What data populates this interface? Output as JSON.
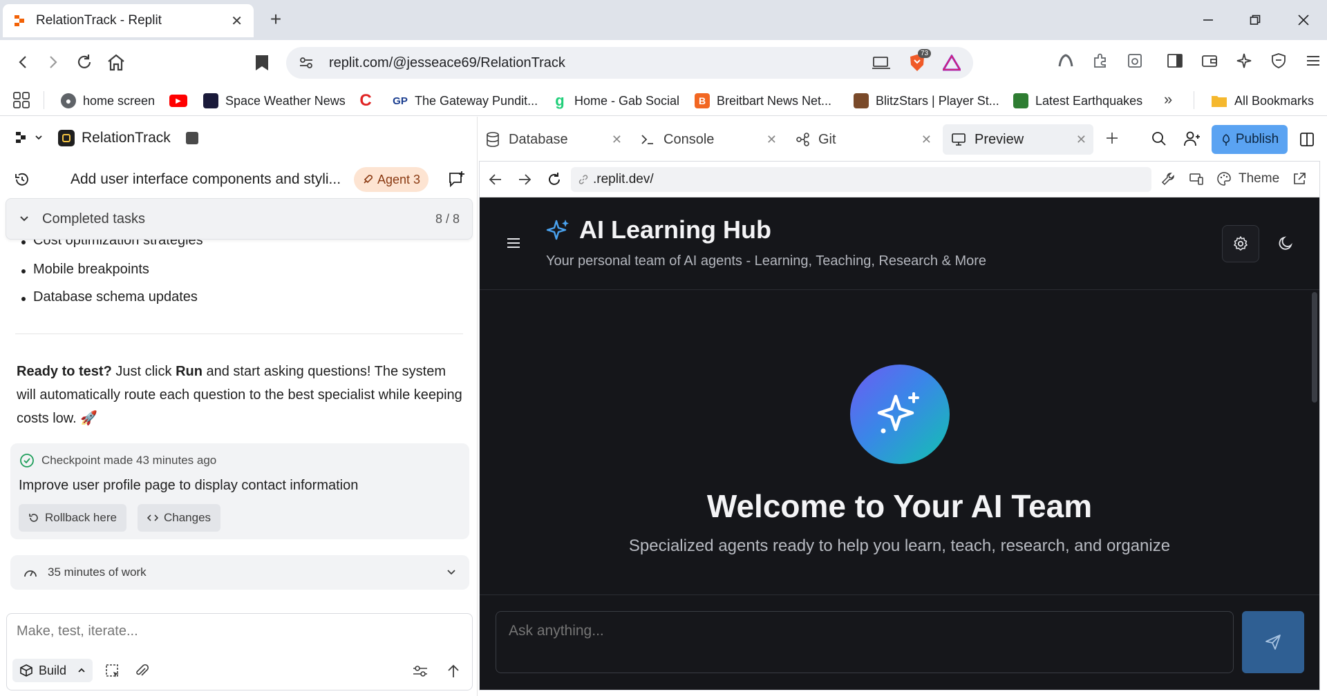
{
  "browser": {
    "tab_title": "RelationTrack - Replit",
    "url": "replit.com/@jesseace69/RelationTrack",
    "brave_badge": "73",
    "bookmarks": [
      {
        "label": "home screen",
        "color": "#5f6368",
        "icon": "globe-icon"
      },
      {
        "label": "",
        "color": "#ff0000",
        "icon": "youtube-icon"
      },
      {
        "label": "Space Weather News",
        "color": "#1a1a3a",
        "icon": "space-weather-icon"
      },
      {
        "label": "",
        "color": "#e02424",
        "icon": "c-logo-icon"
      },
      {
        "label": "The Gateway Pundit...",
        "color": "#1a3d8f",
        "icon": "gp-icon"
      },
      {
        "label": "Home - Gab Social",
        "color": "#21cf7a",
        "icon": "gab-icon"
      },
      {
        "label": "Breitbart News Net...",
        "color": "#f26722",
        "icon": "breitbart-icon"
      },
      {
        "label": "BlitzStars | Player St...",
        "color": "#7a4a2a",
        "icon": "blitzstars-icon"
      },
      {
        "label": "Latest Earthquakes",
        "color": "#2e7d32",
        "icon": "earthquake-icon"
      }
    ],
    "all_bookmarks": "All Bookmarks"
  },
  "left": {
    "project_name": "RelationTrack",
    "chat_title": "Add user interface components and styli...",
    "agent_badge": "Agent 3",
    "tasks_label": "Completed tasks",
    "tasks_count": "8 / 8",
    "bullets": [
      "Cost optimization strategies",
      "Mobile breakpoints",
      "Database schema updates"
    ],
    "ready_bold": "Ready to test?",
    "ready_mid": " Just click ",
    "ready_run": "Run",
    "ready_rest": " and start asking questions! The system will automatically route each question to the best specialist while keeping costs low. 🚀",
    "checkpoint_meta": "Checkpoint made 43 minutes ago",
    "checkpoint_msg": "Improve user profile page to display contact information",
    "rollback_label": "Rollback here",
    "changes_label": "Changes",
    "work_label": "35 minutes of work",
    "composer_placeholder": "Make, test, iterate...",
    "build_label": "Build"
  },
  "right": {
    "tabs": [
      "Database",
      "Console",
      "Git",
      "Preview"
    ],
    "publish_label": "Publish",
    "preview_url": ".replit.dev/",
    "theme_label": "Theme"
  },
  "app": {
    "title": "AI Learning Hub",
    "subtitle": "Your personal team of AI agents - Learning, Teaching, Research & More",
    "welcome": "Welcome to Your AI Team",
    "welcome_sub": "Specialized agents ready to help you learn, teach, research, and organize",
    "ask_placeholder": "Ask anything...",
    "accent": "#4aa3f0"
  }
}
